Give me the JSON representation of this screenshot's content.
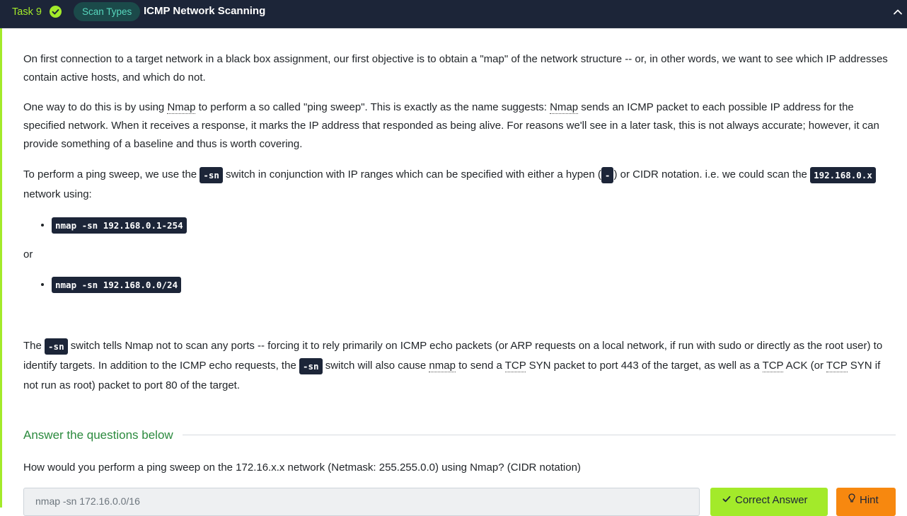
{
  "header": {
    "task_label": "Task 9",
    "category_pill": "Scan Types",
    "title": "ICMP Network Scanning",
    "check_icon": "check-circle-icon",
    "collapse_icon": "chevron-up-icon"
  },
  "content": {
    "para1": "On first connection to a target network in a black box assignment, our first objective is to obtain a \"map\" of the network structure -- or, in other words, we want to see which IP addresses contain active hosts, and which do not.",
    "para2": {
      "t1": "One way to do this is by using ",
      "nmap1": "Nmap",
      "t2": " to perform a so called \"ping sweep\". This is exactly as the name suggests: ",
      "nmap2": "Nmap",
      "t3": " sends an ICMP packet to each possible IP address for the specified network. When it receives a response, it marks the IP address that responded as being alive. For reasons we'll see in a later task, this is not always accurate; however, it can provide something of a baseline and thus is worth covering."
    },
    "para3": {
      "t1": "To perform a ping sweep, we use the ",
      "code1": "-sn",
      "t2": " switch in conjunction with IP ranges which can be specified with either a hypen (",
      "code2": "-",
      "t3": ") or CIDR notation. i.e. we could scan the ",
      "code3": "192.168.0.x",
      "t4": " network using:"
    },
    "list1": [
      "nmap -sn 192.168.0.1-254"
    ],
    "or_text": "or",
    "list2": [
      "nmap -sn 192.168.0.0/24"
    ],
    "para4": {
      "t1": "The ",
      "code1": "-sn",
      "t2": " switch tells Nmap not to scan any ports -- forcing it to rely primarily on ICMP echo packets (or ARP requests on a local network, if run with sudo or directly as the root user) to identify targets. In addition to the ICMP echo requests, the ",
      "code2": "-sn",
      "t3": " switch will also cause ",
      "nmap": "nmap",
      "t4": " to send a ",
      "tcp1": "TCP",
      "t5": " SYN packet to port 443 of the target, as well as a ",
      "tcp2": "TCP",
      "t6": " ACK (or ",
      "tcp3": "TCP",
      "t7": " SYN if not run as root) packet to port 80 of the target."
    }
  },
  "questions": {
    "section_title": "Answer the questions below",
    "q1": "How would you perform a ping sweep on the 172.16.x.x network (Netmask: 255.255.0.0) using Nmap? (CIDR notation)",
    "answer_value": "nmap -sn 172.16.0.0/16",
    "correct_label": "Correct Answer",
    "hint_label": "Hint"
  },
  "colors": {
    "header_bg": "#1c2538",
    "accent_green": "#a3ea2a",
    "hint_orange": "#f7880f",
    "section_green": "#2b8a3e"
  }
}
